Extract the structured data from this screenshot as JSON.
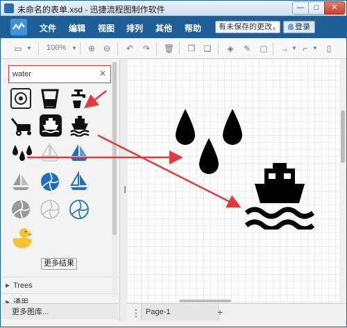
{
  "window": {
    "title": "未命名的表单.xsd - 迅捷流程图制作软件",
    "min_label": "—",
    "max_label": "□",
    "close_label": "✕"
  },
  "header": {
    "menu": [
      "文件",
      "编辑",
      "视图",
      "排列",
      "其他",
      "帮助"
    ],
    "unsaved_notice": "有未保存的更改，点击此处保存",
    "login_label": "登录"
  },
  "toolbar": {
    "zoom": "100%"
  },
  "sidebar": {
    "search": {
      "value": "water",
      "clear_label": "✕"
    },
    "more_results_label": "更多结果",
    "sections": [
      "Trees",
      "通用"
    ],
    "more_libraries_label": "更多图库..."
  },
  "pages": {
    "tabs": [
      "Page-1"
    ],
    "add_label": "+",
    "menu_label": "⋮"
  },
  "colors": {
    "header_blue": "#1f5f97",
    "highlight_red": "#e23b3b",
    "shape_blue": "#1f6fc1"
  },
  "icons": {
    "shapes": [
      "washing-machine-icon",
      "glass-icon",
      "faucet-icon",
      "lawn-mower-icon",
      "ship-badge-icon",
      "ship-icon",
      "water-drops-icon",
      "sailboat-outline-icon",
      "sailboat-blue-icon",
      "sailboat-gray-icon",
      "volleyball-blue-icon",
      "sailboat-blue-small-icon",
      "volleyball-gray-icon",
      "volleyball-outline-icon",
      "volleyball-blue-outline-icon",
      "rubber-duck-icon"
    ]
  }
}
